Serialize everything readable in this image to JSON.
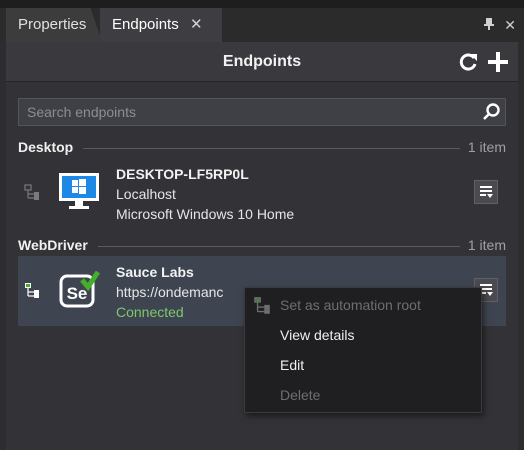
{
  "tabs": [
    {
      "label": "Properties"
    },
    {
      "label": "Endpoints"
    }
  ],
  "window_controls": {
    "pin": "pin-icon",
    "close": "close-icon"
  },
  "header": {
    "title": "Endpoints"
  },
  "search": {
    "placeholder": "Search endpoints",
    "value": ""
  },
  "groups": [
    {
      "name": "Desktop",
      "count": "1 item",
      "endpoints": [
        {
          "title": "DESKTOP-LF5RP0L",
          "line2": "Localhost",
          "line3": "Microsoft Windows 10 Home",
          "icon": "windows-monitor-icon"
        }
      ]
    },
    {
      "name": "WebDriver",
      "count": "1 item",
      "endpoints": [
        {
          "title": "Sauce Labs",
          "line2": "https://ondemanc",
          "line3": "Connected",
          "icon": "selenium-icon"
        }
      ]
    }
  ],
  "context_menu": {
    "items": [
      {
        "label": "Set as automation root",
        "enabled": false
      },
      {
        "label": "View details",
        "enabled": true
      },
      {
        "label": "Edit",
        "enabled": true
      },
      {
        "label": "Delete",
        "enabled": false
      }
    ]
  },
  "colors": {
    "background": "#2d2d30",
    "selected_row": "#3e4550",
    "connected": "#7ec86c",
    "windows_blue": "#1e88e5",
    "selenium_green": "#43b02a"
  }
}
